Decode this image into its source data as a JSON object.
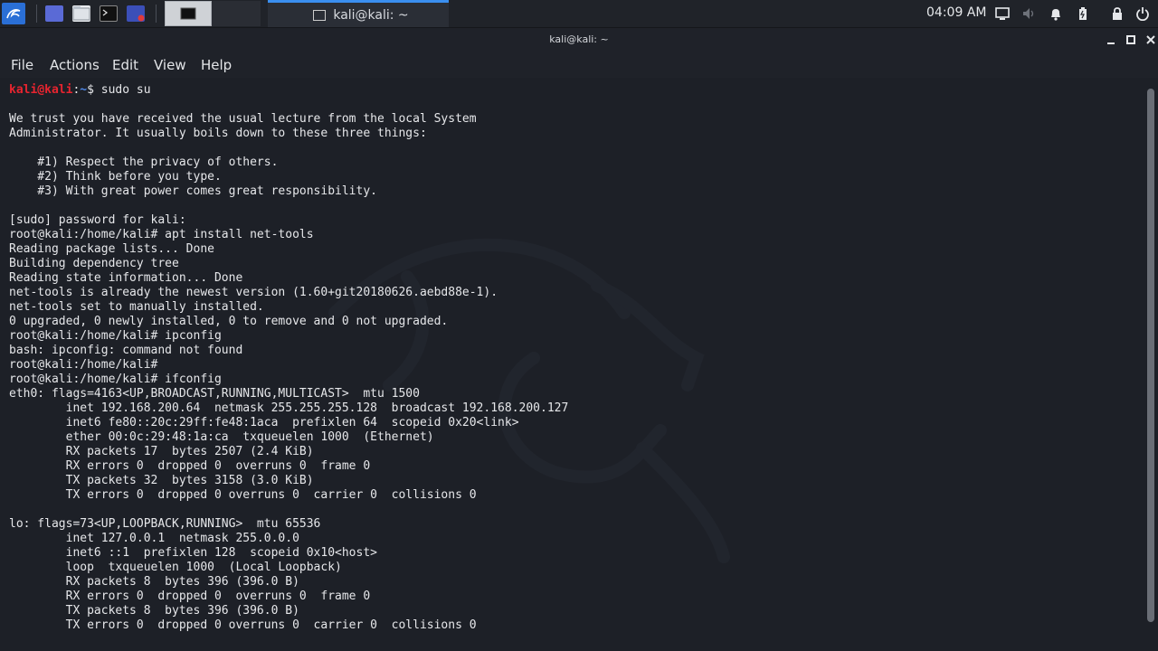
{
  "panel": {
    "task_title": "kali@kali: ~",
    "clock": "04:09 AM",
    "icons": [
      "kali-menu-icon",
      "show-desktop-icon",
      "file-manager-icon",
      "terminal-icon",
      "screenshot-icon",
      "display-icon",
      "volume-icon",
      "notification-bell-icon",
      "battery-icon",
      "lock-icon",
      "power-icon"
    ]
  },
  "window": {
    "title": "kali@kali: ~"
  },
  "menu": {
    "file": "File",
    "actions": "Actions",
    "edit": "Edit",
    "view": "View",
    "help": "Help"
  },
  "terminal": {
    "prompt_user": "kali@kali",
    "prompt_sep": ":",
    "prompt_path": "~",
    "prompt_symbol": "$",
    "first_command": " sudo su",
    "output": "\nWe trust you have received the usual lecture from the local System\nAdministrator. It usually boils down to these three things:\n\n    #1) Respect the privacy of others.\n    #2) Think before you type.\n    #3) With great power comes great responsibility.\n\n[sudo] password for kali:\nroot@kali:/home/kali# apt install net-tools\nReading package lists... Done\nBuilding dependency tree\nReading state information... Done\nnet-tools is already the newest version (1.60+git20180626.aebd88e-1).\nnet-tools set to manually installed.\n0 upgraded, 0 newly installed, 0 to remove and 0 not upgraded.\nroot@kali:/home/kali# ipconfig\nbash: ipconfig: command not found\nroot@kali:/home/kali#\nroot@kali:/home/kali# ifconfig\neth0: flags=4163<UP,BROADCAST,RUNNING,MULTICAST>  mtu 1500\n        inet 192.168.200.64  netmask 255.255.255.128  broadcast 192.168.200.127\n        inet6 fe80::20c:29ff:fe48:1aca  prefixlen 64  scopeid 0x20<link>\n        ether 00:0c:29:48:1a:ca  txqueuelen 1000  (Ethernet)\n        RX packets 17  bytes 2507 (2.4 KiB)\n        RX errors 0  dropped 0  overruns 0  frame 0\n        TX packets 32  bytes 3158 (3.0 KiB)\n        TX errors 0  dropped 0 overruns 0  carrier 0  collisions 0\n\nlo: flags=73<UP,LOOPBACK,RUNNING>  mtu 65536\n        inet 127.0.0.1  netmask 255.0.0.0\n        inet6 ::1  prefixlen 128  scopeid 0x10<host>\n        loop  txqueuelen 1000  (Local Loopback)\n        RX packets 8  bytes 396 (396.0 B)\n        RX errors 0  dropped 0  overruns 0  frame 0\n        TX packets 8  bytes 396 (396.0 B)\n        TX errors 0  dropped 0 overruns 0  carrier 0  collisions 0"
  }
}
